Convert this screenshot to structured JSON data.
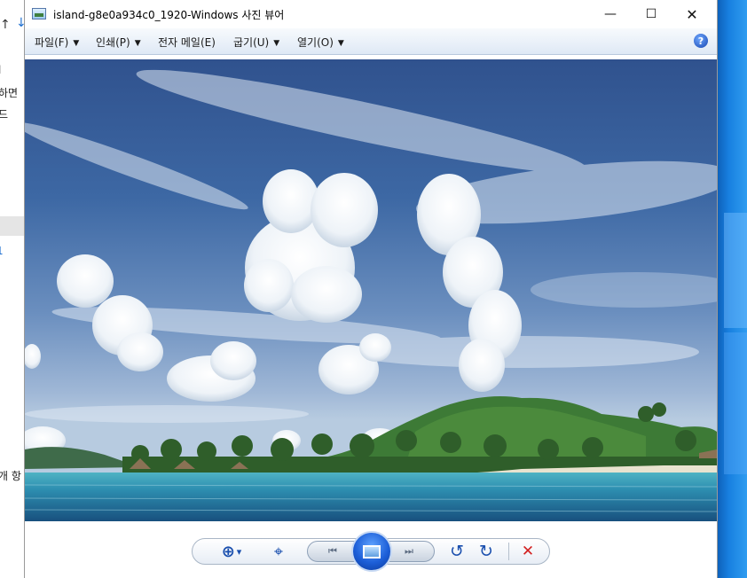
{
  "background_window": {
    "fragments": [
      "l",
      "하면",
      "드"
    ],
    "link_fragment": "1",
    "bottom_fragment": "개 항"
  },
  "window": {
    "title": "island-g8e0a934c0_1920-Windows 사진 뷰어",
    "minimize_glyph": "—",
    "maximize_glyph": "☐",
    "close_glyph": "✕"
  },
  "menu": {
    "items": [
      {
        "label": "파일(F)",
        "has_dropdown": true
      },
      {
        "label": "인쇄(P)",
        "has_dropdown": true
      },
      {
        "label": "전자 메일(E)",
        "has_dropdown": false
      },
      {
        "label": "굽기(U)",
        "has_dropdown": true
      },
      {
        "label": "열기(O)",
        "has_dropdown": true
      }
    ],
    "dropdown_glyph": "▼",
    "help_glyph": "?"
  },
  "controls": {
    "zoom_glyph": "⊕",
    "zoom_dropdown_glyph": "▾",
    "fit_glyph": "⌖",
    "prev_glyph": "⏮",
    "next_glyph": "⏭",
    "rotate_ccw_glyph": "↺",
    "rotate_cw_glyph": "↻",
    "delete_glyph": "✕"
  },
  "colors": {
    "accent": "#1a4fae",
    "delete": "#d32020",
    "menubar_top": "#f7fafd",
    "menubar_bottom": "#dfe9f5"
  }
}
